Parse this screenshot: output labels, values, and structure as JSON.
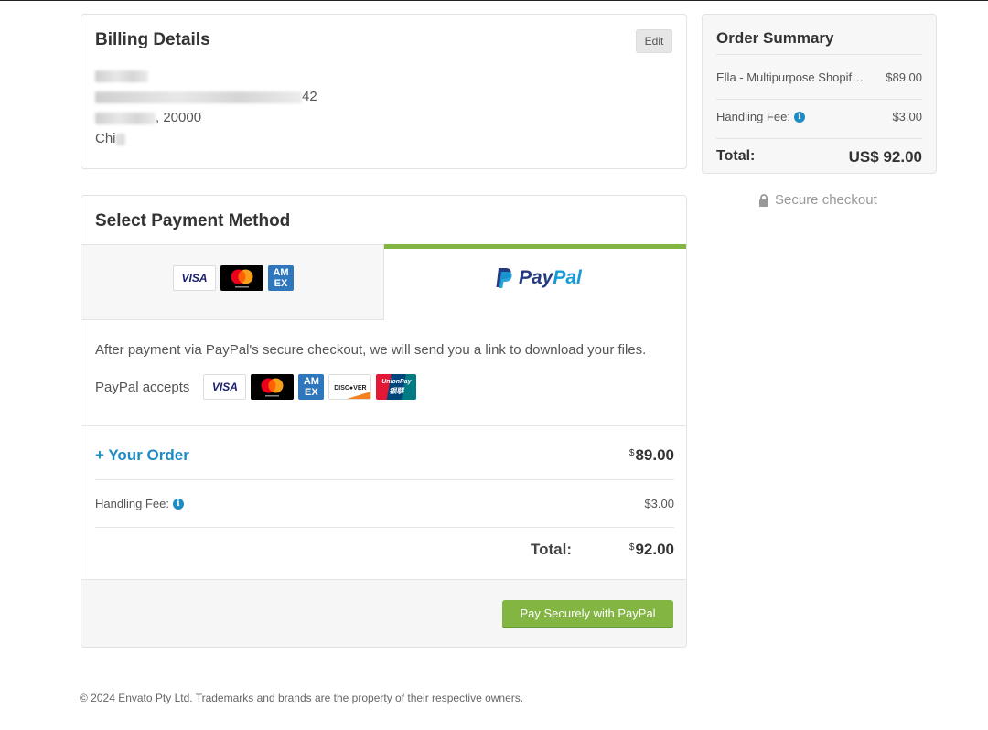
{
  "billing": {
    "title": "Billing Details",
    "edit_label": "Edit",
    "address_line2_suffix": "42",
    "address_line3_suffix": ", 20000",
    "address_line4": "Chi"
  },
  "payment": {
    "title": "Select Payment Method",
    "paypal_logo_text_1": "Pay",
    "paypal_logo_text_2": "Pal",
    "info_text": "After payment via PayPal's secure checkout, we will send you a link to download your files.",
    "accepts_label": "PayPal accepts",
    "your_order_label": "+ Your Order",
    "your_order_currency": "$",
    "your_order_amount": "89.00",
    "handling_fee_label": "Handling Fee:",
    "handling_fee_amount": "$3.00",
    "total_label": "Total:",
    "total_currency": "$",
    "total_amount": "92.00",
    "pay_button_label": "Pay Securely with PayPal"
  },
  "card_logos": {
    "visa": "VISA",
    "amex_1": "AM",
    "amex_2": "EX",
    "discover": "DISC●VER",
    "unionpay_1": "UnionPay",
    "unionpay_2": "银联"
  },
  "summary": {
    "title": "Order Summary",
    "item_name": "Ella - Multipurpose Shopif…",
    "item_price": "$89.00",
    "handling_fee_label": "Handling Fee:",
    "handling_fee_amount": "$3.00",
    "total_label": "Total:",
    "total_amount": "US$ 92.00"
  },
  "secure_checkout": "Secure checkout",
  "footer": {
    "copyright": "© 2024 Envato Pty Ltd. Trademarks and brands are the property of their respective owners."
  },
  "colors": {
    "accent_green": "#82b541",
    "link_blue": "#1e8bc3",
    "paypal_dark": "#253b80",
    "paypal_light": "#179bd7"
  }
}
